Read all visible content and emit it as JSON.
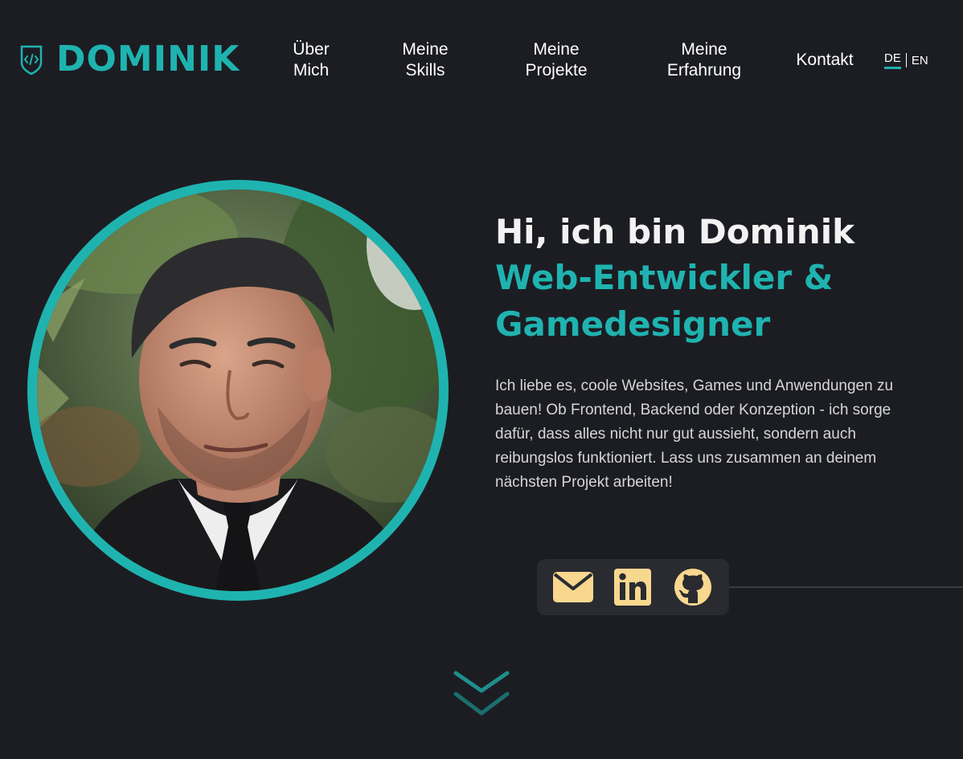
{
  "header": {
    "logo_text": "DOMINIK",
    "logo_icon": "code-shield-icon",
    "nav": [
      {
        "label": "Über\nMich"
      },
      {
        "label": "Meine\nSkills"
      },
      {
        "label": "Meine\nProjekte"
      },
      {
        "label": "Meine\nErfahrung"
      },
      {
        "label": "Kontakt"
      }
    ],
    "lang": {
      "de": "DE",
      "en": "EN",
      "active": "DE"
    }
  },
  "hero": {
    "greeting": "Hi, ich bin Dominik",
    "role": "Web-Entwickler & Gamedesigner",
    "description": "Ich liebe es, coole Websites, Games und Anwendungen zu bauen! Ob Frontend, Backend oder Konzeption - ich sorge dafür, dass alles nicht nur gut aussieht, sondern auch reibungslos funktioniert. Lass uns zusammen an deinem nächsten Projekt arbeiten!"
  },
  "social": {
    "icons": [
      "email-icon",
      "linkedin-icon",
      "github-icon"
    ]
  },
  "colors": {
    "background": "#1c1d22",
    "accent": "#1fb3b0",
    "icon": "#f7d88e",
    "panel": "#2a2b31"
  }
}
